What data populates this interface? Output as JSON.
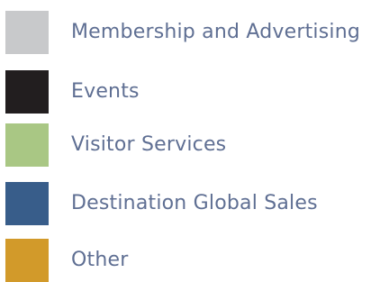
{
  "legend": {
    "items": [
      {
        "label": "Membership and Advertising",
        "color": "#c8c9cb"
      },
      {
        "label": "Events",
        "color": "#221e1f"
      },
      {
        "label": "Visitor Services",
        "color": "#a9c784"
      },
      {
        "label": "Destination Global Sales",
        "color": "#385d8a"
      },
      {
        "label": "Other",
        "color": "#d29a2a"
      }
    ]
  }
}
